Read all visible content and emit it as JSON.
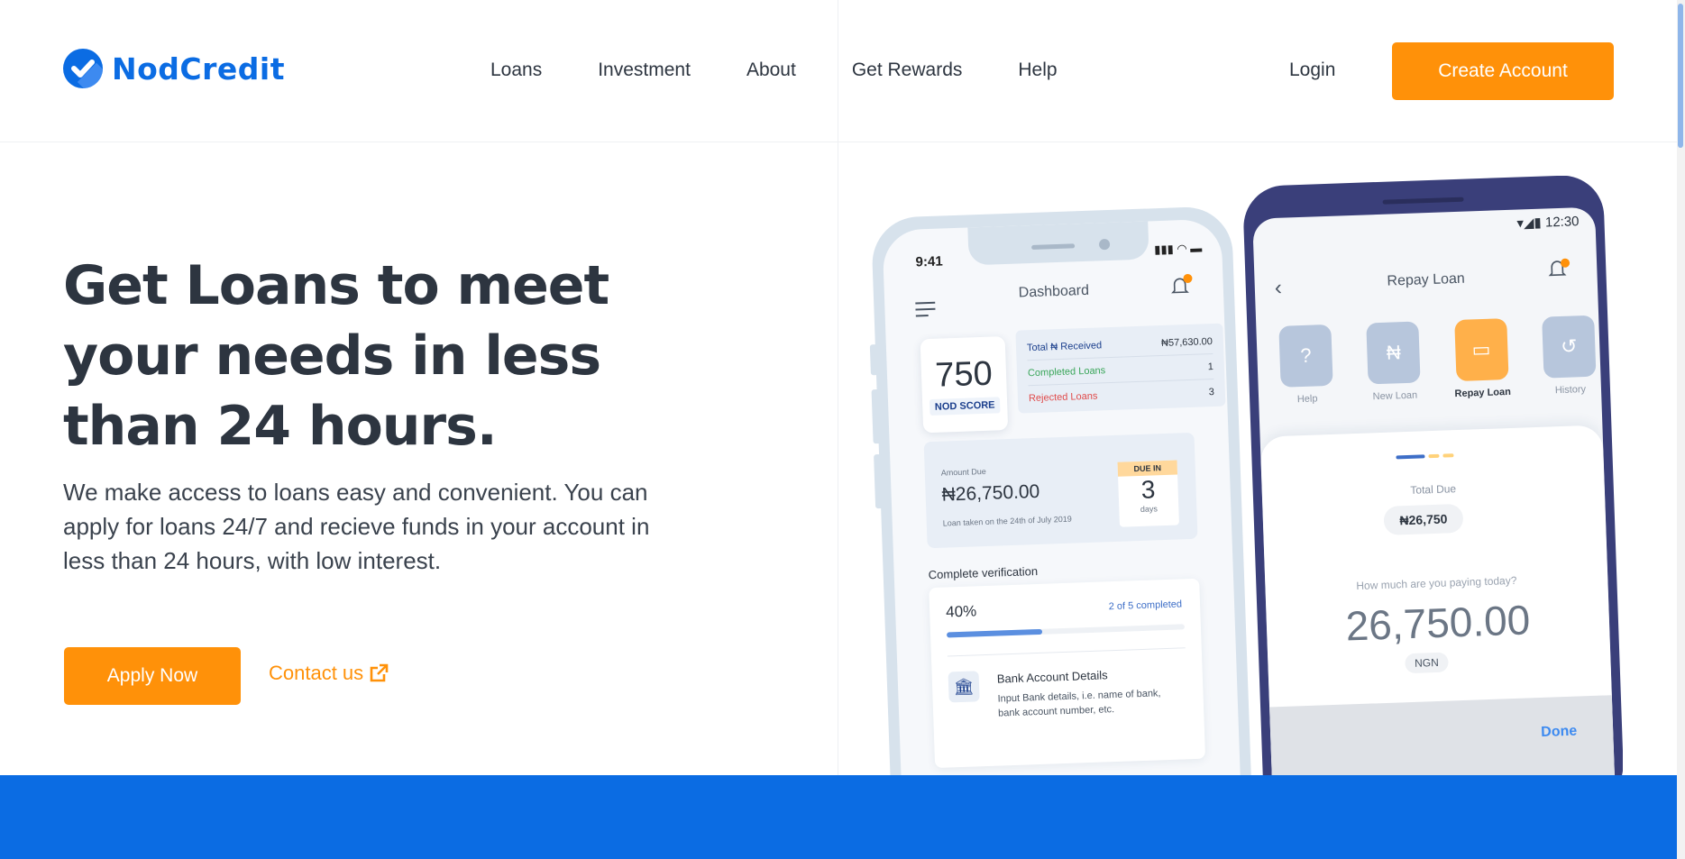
{
  "brand": {
    "name": "NodCredit",
    "color": "#0b6ce3",
    "accent": "#ff9109"
  },
  "nav": {
    "items": [
      "Loans",
      "Investment",
      "About",
      "Get Rewards",
      "Help"
    ],
    "login": "Login",
    "create_account": "Create Account"
  },
  "hero": {
    "title": "Get Loans to meet your needs in less than 24 hours.",
    "subtitle": "We make access to loans easy and convenient. You can apply for loans 24/7 and recieve funds in your account in less than 24 hours, with low interest.",
    "apply_button": "Apply Now",
    "contact_link": "Contact us"
  },
  "dashboard_phone": {
    "time": "9:41",
    "title": "Dashboard",
    "score": "750",
    "score_label": "NOD SCORE",
    "stats": [
      {
        "label": "Total ₦ Received",
        "value": "₦57,630.00",
        "color": "#1a3e8c"
      },
      {
        "label": "Completed Loans",
        "value": "1",
        "color": "#3aa65a"
      },
      {
        "label": "Rejected Loans",
        "value": "3",
        "color": "#e04b4b"
      }
    ],
    "amount_due_label": "Amount Due",
    "amount_due": "₦26,750.00",
    "loan_note": "Loan taken on the 24th of July 2019",
    "due_in_label": "DUE IN",
    "due_in_value": "3",
    "due_in_unit": "days",
    "verification_title": "Complete verification",
    "verification_percent": "40%",
    "verification_progress": 0.4,
    "verification_count": "2 of 5 completed",
    "bank_title": "Bank Account Details",
    "bank_desc": "Input Bank details, i.e. name of bank, bank account number, etc."
  },
  "repay_phone": {
    "time": "12:30",
    "title": "Repay Loan",
    "tiles": [
      {
        "label": "Help",
        "icon": "question-icon"
      },
      {
        "label": "New Loan",
        "icon": "money-bag-icon"
      },
      {
        "label": "Repay Loan",
        "icon": "card-icon"
      },
      {
        "label": "History",
        "icon": "history-icon"
      }
    ],
    "total_due_label": "Total Due",
    "total_due": "₦26,750",
    "question": "How much are you paying today?",
    "amount": "26,750.00",
    "currency": "NGN",
    "done": "Done"
  }
}
